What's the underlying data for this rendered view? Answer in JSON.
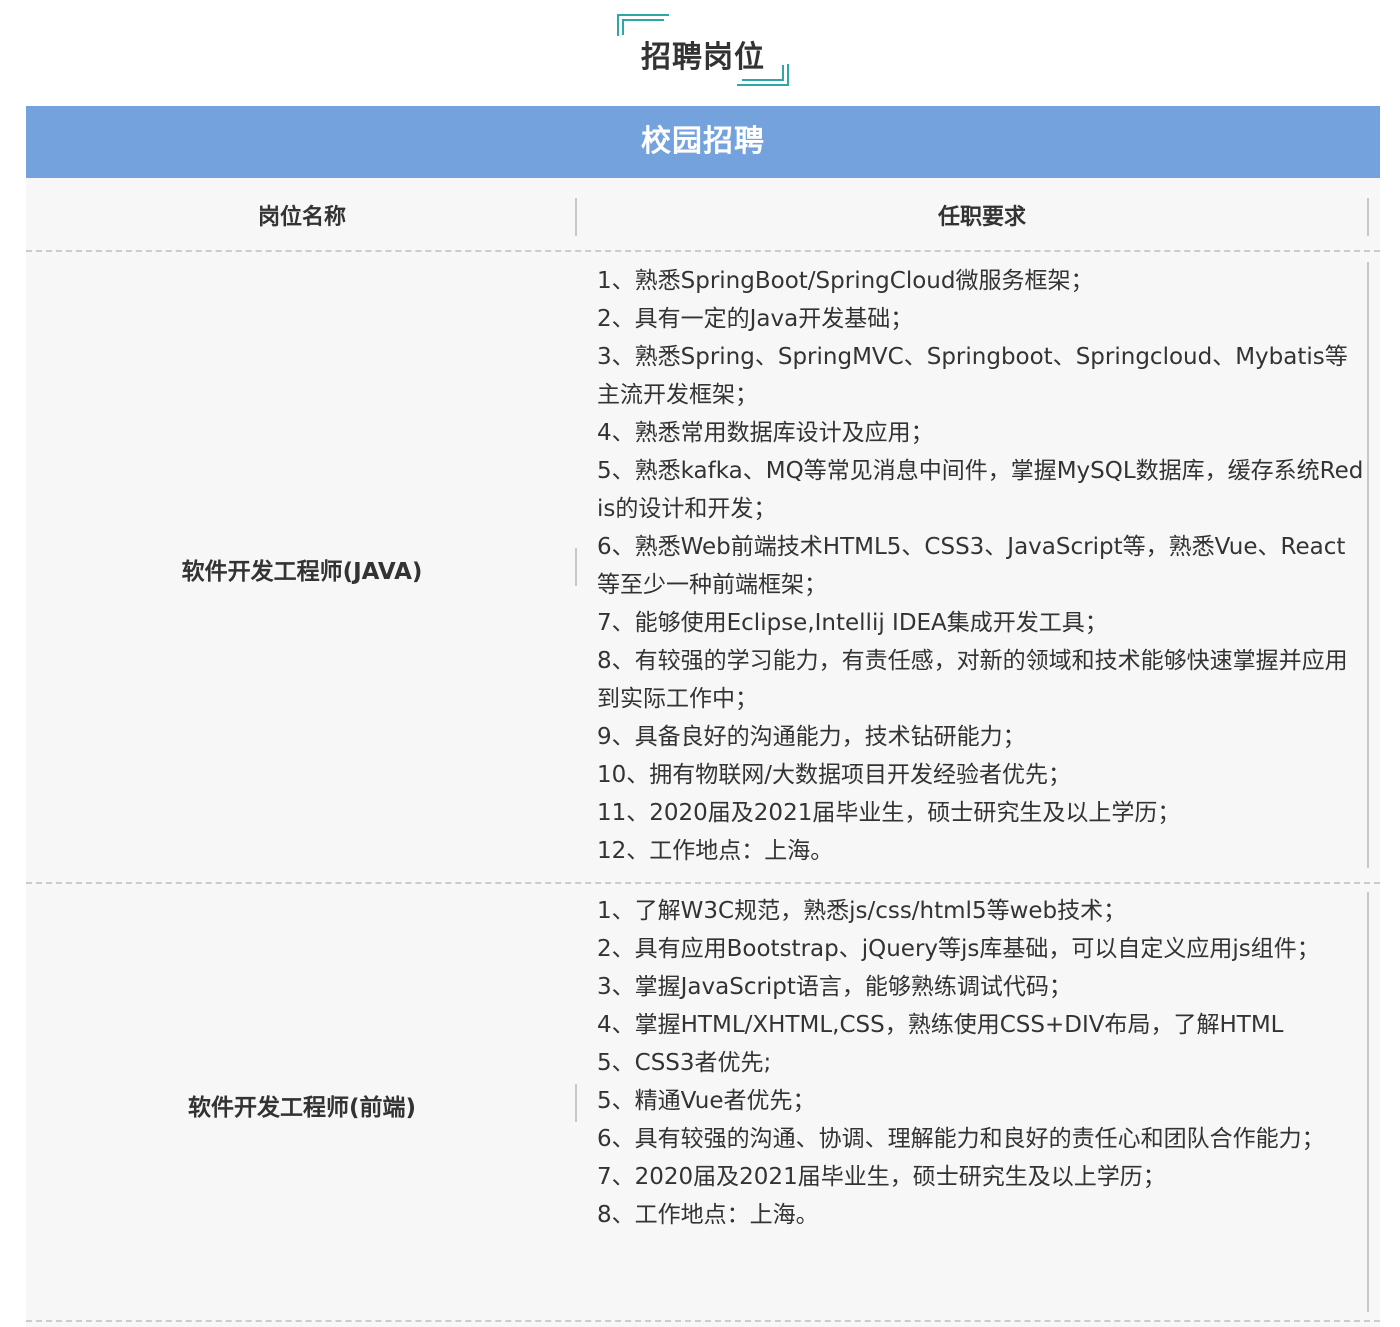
{
  "page": {
    "section_title": "招聘岗位",
    "banner": "校园招聘"
  },
  "colors": {
    "banner_bg": "#74a2dd",
    "accent_corner": "#2fa7a7",
    "table_bg": "#f7f7f7"
  },
  "table": {
    "headers": {
      "position": "岗位名称",
      "requirements": "任职要求"
    },
    "rows": [
      {
        "position": "软件开发工程师(JAVA)",
        "requirements": [
          "1、熟悉SpringBoot/SpringCloud微服务框架；",
          "2、具有一定的Java开发基础；",
          "3、熟悉Spring、SpringMVC、Springboot、Springcloud、Mybatis等主流开发框架；",
          "4、熟悉常用数据库设计及应用；",
          "5、熟悉kafka、MQ等常见消息中间件，掌握MySQL数据库，缓存系统Redis的设计和开发；",
          "6、熟悉Web前端技术HTML5、CSS3、JavaScript等，熟悉Vue、React等至少一种前端框架；",
          "7、能够使用Eclipse,Intellij IDEA集成开发工具；",
          "8、有较强的学习能力，有责任感，对新的领域和技术能够快速掌握并应用到实际工作中；",
          "9、具备良好的沟通能力，技术钻研能力；",
          "10、拥有物联网/大数据项目开发经验者优先；",
          "11、2020届及2021届毕业生，硕士研究生及以上学历；",
          "12、工作地点：上海。"
        ]
      },
      {
        "position": "软件开发工程师(前端)",
        "requirements": [
          "1、了解W3C规范，熟悉js/css/html5等web技术；",
          "2、具有应用Bootstrap、jQuery等js库基础，可以自定义应用js组件；",
          "3、掌握JavaScript语言，能够熟练调试代码；",
          "4、掌握HTML/XHTML,CSS，熟练使用CSS+DIV布局，了解HTML",
          "5、CSS3者优先;",
          "5、精通Vue者优先；",
          "6、具有较强的沟通、协调、理解能力和良好的责任心和团队合作能力；",
          "7、2020届及2021届毕业生，硕士研究生及以上学历；",
          "8、工作地点：上海。"
        ]
      }
    ]
  }
}
